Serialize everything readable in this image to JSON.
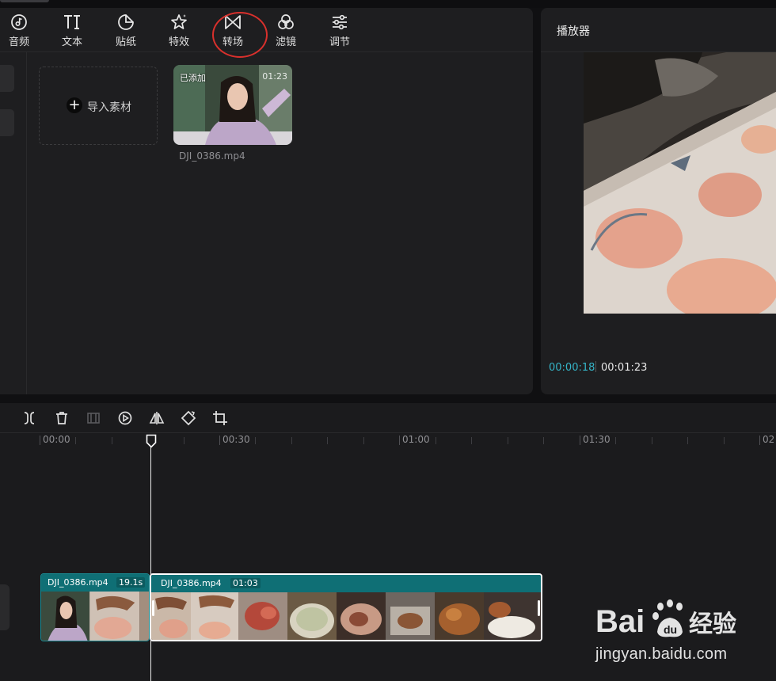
{
  "theme": {
    "accent": "#35b5c8",
    "clip_header": "#0f6f75",
    "highlight": "#d9302c"
  },
  "toolbar": {
    "items": [
      {
        "label": "音频",
        "icon": "audio-icon"
      },
      {
        "label": "文本",
        "icon": "text-icon"
      },
      {
        "label": "贴纸",
        "icon": "sticker-icon"
      },
      {
        "label": "特效",
        "icon": "effects-icon"
      },
      {
        "label": "转场",
        "icon": "transition-icon",
        "highlighted": true
      },
      {
        "label": "滤镜",
        "icon": "filter-icon"
      },
      {
        "label": "调节",
        "icon": "adjust-icon"
      }
    ]
  },
  "media": {
    "import_label": "导入素材",
    "item": {
      "badge": "已添加",
      "duration": "01:23",
      "filename": "DJI_0386.mp4"
    }
  },
  "player": {
    "title": "播放器",
    "current_time": "00:00:18",
    "total_time": "00:01:23"
  },
  "timeline": {
    "ruler_labels": [
      "00:00",
      "00:30",
      "01:00",
      "01:30",
      "02"
    ],
    "tools": [
      "split-icon",
      "delete-icon",
      "freeze-icon",
      "play-circle-icon",
      "mirror-icon",
      "rotate-icon",
      "crop-icon"
    ],
    "clips": [
      {
        "name": "DJI_0386.mp4",
        "duration": "19.1s"
      },
      {
        "name": "DJI_0386.mp4",
        "duration": "01:03"
      }
    ]
  },
  "watermark": {
    "logo": "Bai 经验",
    "url": "jingyan.baidu.com"
  }
}
